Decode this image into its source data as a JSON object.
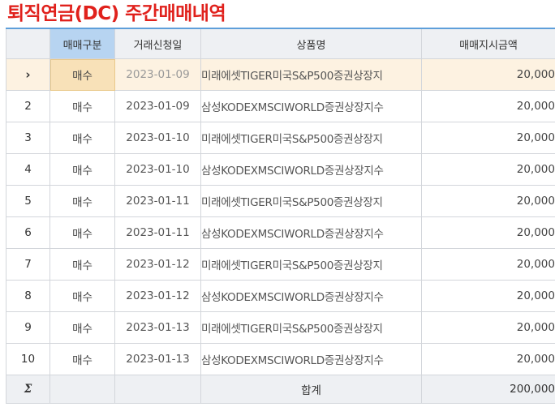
{
  "title": "퇴직연금(DC) 주간매매내역",
  "columns": [
    "",
    "매매구분",
    "거래신청일",
    "상품명",
    "매매지시금액"
  ],
  "rows": [
    {
      "no": "›",
      "type": "매수",
      "date": "2023-01-09",
      "product": "미래에셋TIGER미국S&P500증권상장지",
      "amount": "20,000"
    },
    {
      "no": "2",
      "type": "매수",
      "date": "2023-01-09",
      "product": "삼성KODEXMSCIWORLD증권상장지수",
      "amount": "20,000"
    },
    {
      "no": "3",
      "type": "매수",
      "date": "2023-01-10",
      "product": "미래에셋TIGER미국S&P500증권상장지",
      "amount": "20,000"
    },
    {
      "no": "4",
      "type": "매수",
      "date": "2023-01-10",
      "product": "삼성KODEXMSCIWORLD증권상장지수",
      "amount": "20,000"
    },
    {
      "no": "5",
      "type": "매수",
      "date": "2023-01-11",
      "product": "미래에셋TIGER미국S&P500증권상장지",
      "amount": "20,000"
    },
    {
      "no": "6",
      "type": "매수",
      "date": "2023-01-11",
      "product": "삼성KODEXMSCIWORLD증권상장지수",
      "amount": "20,000"
    },
    {
      "no": "7",
      "type": "매수",
      "date": "2023-01-12",
      "product": "미래에셋TIGER미국S&P500증권상장지",
      "amount": "20,000"
    },
    {
      "no": "8",
      "type": "매수",
      "date": "2023-01-12",
      "product": "삼성KODEXMSCIWORLD증권상장지수",
      "amount": "20,000"
    },
    {
      "no": "9",
      "type": "매수",
      "date": "2023-01-13",
      "product": "미래에셋TIGER미국S&P500증권상장지",
      "amount": "20,000"
    },
    {
      "no": "10",
      "type": "매수",
      "date": "2023-01-13",
      "product": "삼성KODEXMSCIWORLD증권상장지수",
      "amount": "20,000"
    }
  ],
  "footer": {
    "sigma": "Σ",
    "label": "합계",
    "total": "200,000"
  },
  "colors": {
    "title": "#e0211c",
    "header_bg": "#eef0f3",
    "selected_header_bg": "#b7d4f1",
    "active_row_bg": "#fdf2e1",
    "active_cell_bg": "#f8e1b8",
    "grid_border": "#d3d6db",
    "header_top_border": "#5e9fda"
  }
}
